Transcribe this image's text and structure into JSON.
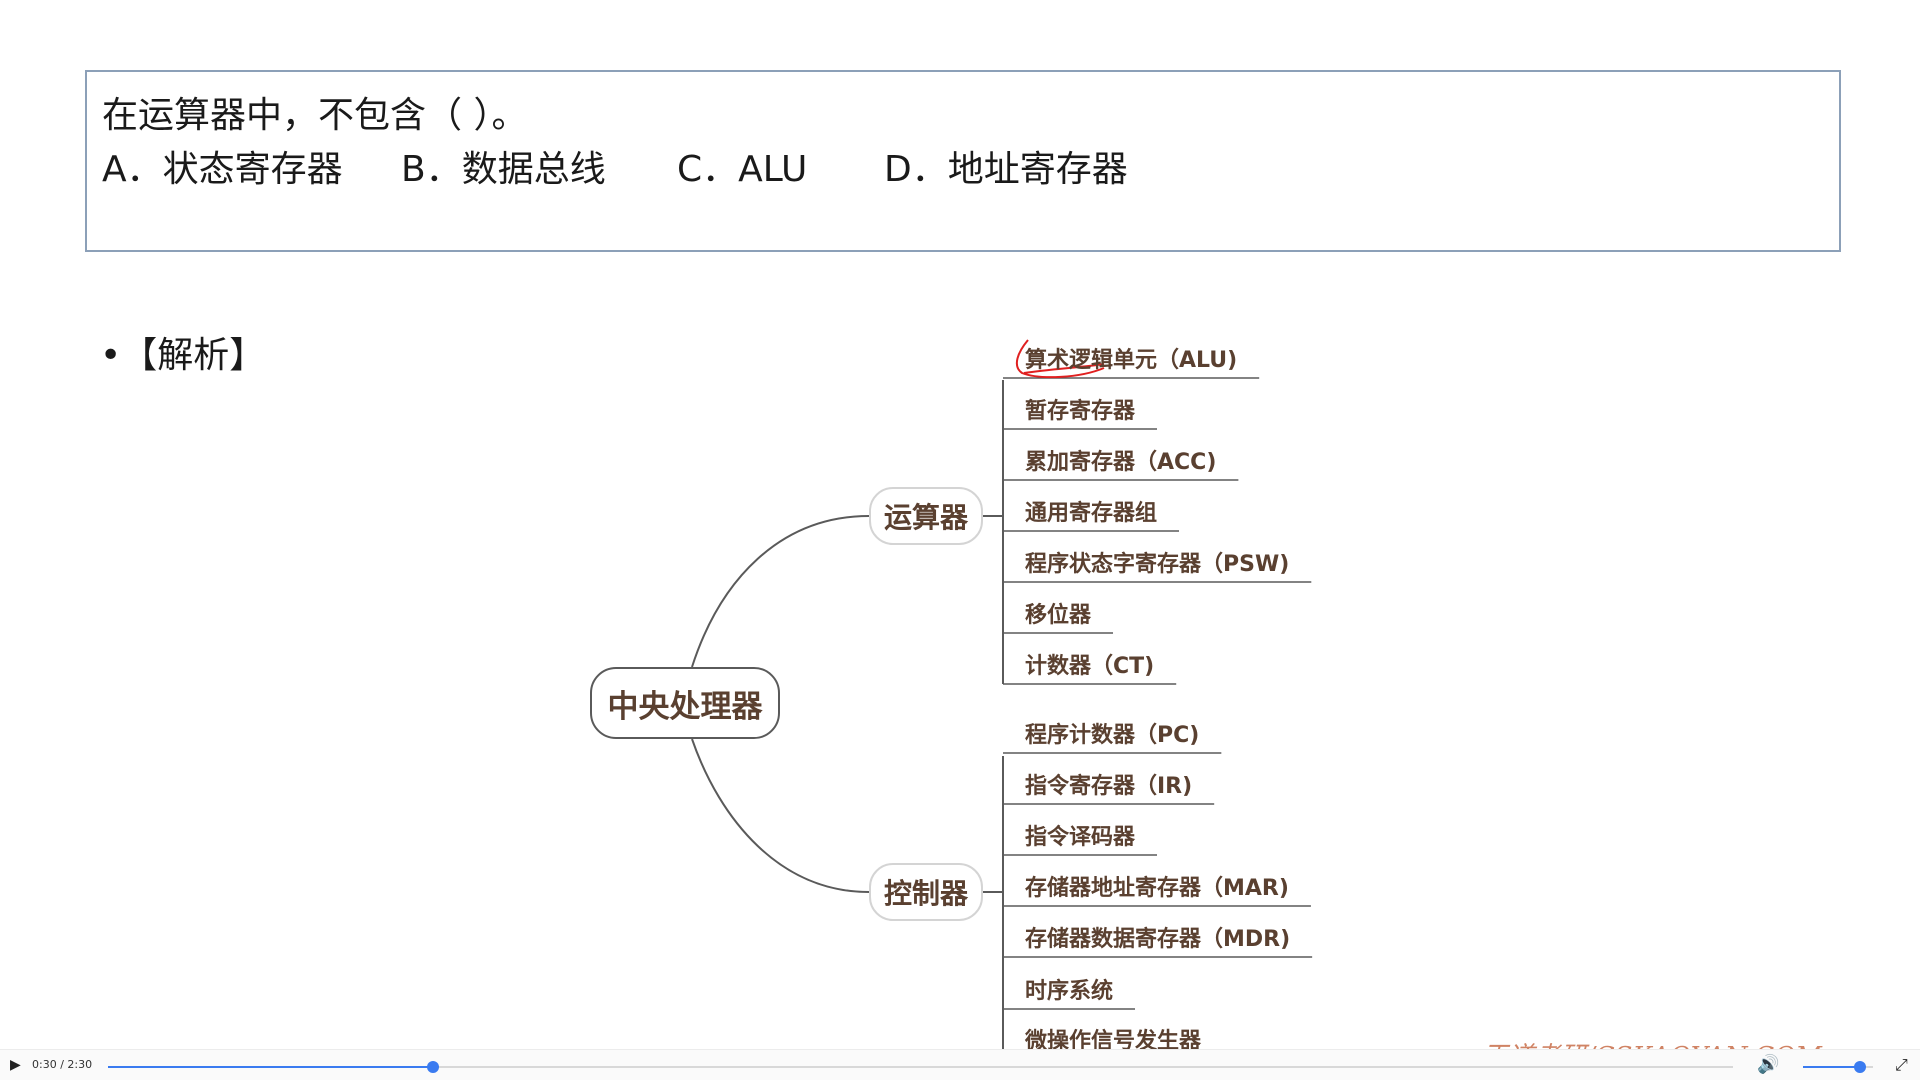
{
  "question": {
    "stem": "在运算器中，不包含（    ）。",
    "options": [
      "A．状态寄存器",
      "B．数据总线",
      "C．ALU",
      "D．地址寄存器"
    ]
  },
  "analysis_label": "•【解析】",
  "mindmap": {
    "root": "中央处理器",
    "alu": {
      "label": "运算器",
      "items": [
        "算术逻辑单元（ALU)",
        "暂存寄存器",
        "累加寄存器（ACC)",
        "通用寄存器组",
        "程序状态字寄存器（PSW)",
        "移位器",
        "计数器（CT)"
      ]
    },
    "cu": {
      "label": "控制器",
      "items": [
        "程序计数器（PC)",
        "指令寄存器（IR)",
        "指令译码器",
        "存储器地址寄存器（MAR)",
        "存储器数据寄存器（MDR)",
        "时序系统",
        "微操作信号发生器"
      ]
    }
  },
  "watermark": "王道考研/CSKAOYAN.COM",
  "player": {
    "time": "0:30 / 2:30",
    "progress_fraction": 0.2,
    "volume_fraction": 0.82,
    "icons": {
      "play": "play-icon",
      "volume": "volume-icon",
      "fullscreen": "exit-fullscreen-icon"
    }
  },
  "colors": {
    "accent": "#3a7bf0",
    "node_text": "#5a4030",
    "annotation": "#e02020",
    "watermark": "#c86e4a"
  }
}
